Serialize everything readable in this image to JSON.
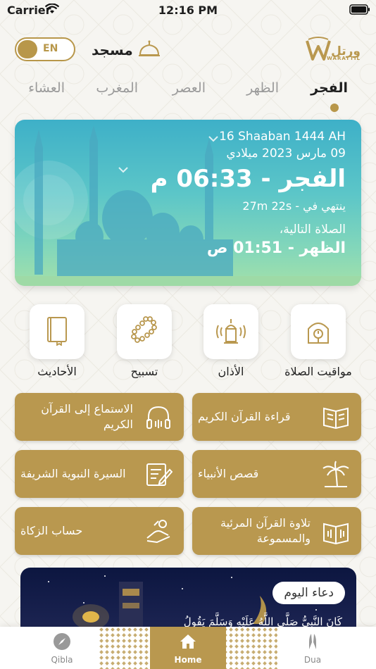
{
  "status_bar": {
    "carrier": "Carrier",
    "time": "12:16 PM"
  },
  "header": {
    "language_toggle": "EN",
    "masjid_label": "مسجد",
    "logo_text": "ورتل",
    "logo_sub": "WARATTIL",
    "accent_color": "#b9984f"
  },
  "prayer_tabs": [
    {
      "label": "الفجر",
      "active": true
    },
    {
      "label": "الظهر",
      "active": false
    },
    {
      "label": "العصر",
      "active": false
    },
    {
      "label": "المغرب",
      "active": false
    },
    {
      "label": "العشاء",
      "active": false
    }
  ],
  "hero": {
    "hijri_date": "16 Shaaban 1444 AH",
    "gregorian_date": "09 مارس 2023 ميلادي",
    "current_prayer": "الفجر - 06:33 م",
    "ends_in": "ينتهي في - 27m 22s",
    "next_label": "الصلاة التالية،",
    "next_prayer": "الظهر - 01:51 ص"
  },
  "features": [
    {
      "label": "مواقيت الصلاة",
      "icon": "mosque-clock-icon"
    },
    {
      "label": "الأذان",
      "icon": "azan-speaker-icon"
    },
    {
      "label": "تسبيح",
      "icon": "tasbih-beads-icon"
    },
    {
      "label": "الأحاديث",
      "icon": "book-icon"
    }
  ],
  "buttons": [
    {
      "label": "قراءة القرآن الكريم",
      "icon": "open-quran-icon"
    },
    {
      "label": "الاستماع إلى القرآن الكريم",
      "icon": "headphones-icon"
    },
    {
      "label": "قصص الأنبياء",
      "icon": "palm-tree-icon"
    },
    {
      "label": "السيرة النبوية الشريفة",
      "icon": "writing-icon"
    },
    {
      "label": "تلاوة القرآن المرئية والمسموعة",
      "icon": "quran-audio-icon"
    },
    {
      "label": "حساب الزكاة",
      "icon": "zakat-hand-icon"
    }
  ],
  "dua": {
    "title": "دعاء اليوم",
    "text": "كَانَ النَّبِيُّ صَلَّى اللَّهُ عَلَيْهِ وَسَلَّمَ يَقُولُ"
  },
  "tabbar": [
    {
      "label": "Qibla",
      "icon": "compass-icon"
    },
    {
      "label": "Home",
      "icon": "home-icon",
      "active": true
    },
    {
      "label": "Dua",
      "icon": "praying-hands-icon"
    }
  ]
}
